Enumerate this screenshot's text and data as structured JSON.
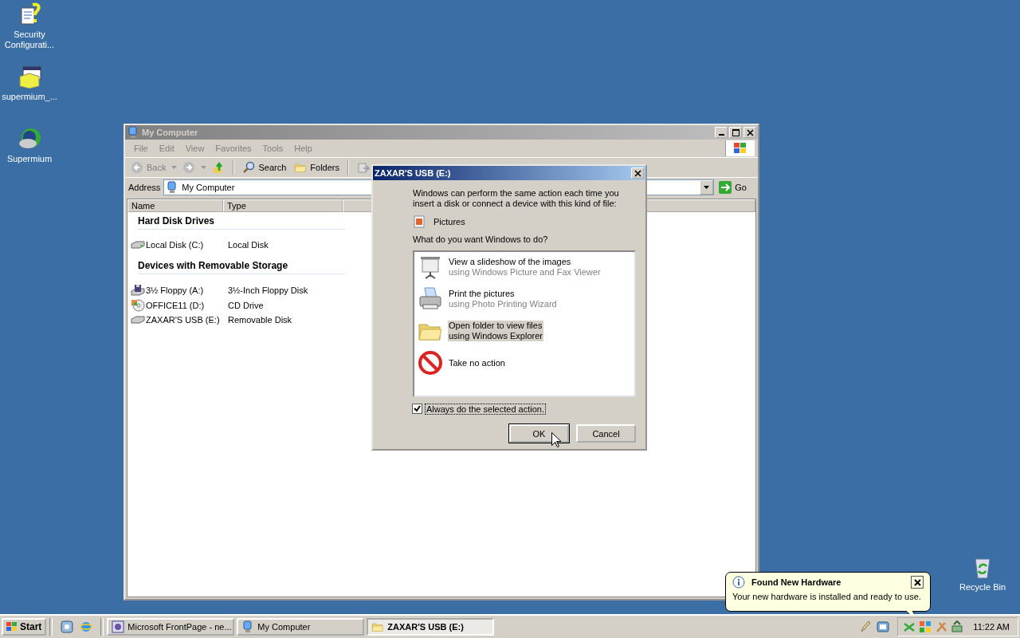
{
  "desktop_icons": [
    {
      "label": "Security Configurati...",
      "kind": "security"
    },
    {
      "label": "supermium_...",
      "kind": "installer"
    },
    {
      "label": "Supermium",
      "kind": "app"
    },
    {
      "label": "Recycle Bin",
      "kind": "recycle"
    }
  ],
  "explorer": {
    "title": "My Computer",
    "menu": [
      "File",
      "Edit",
      "View",
      "Favorites",
      "Tools",
      "Help"
    ],
    "toolbar": {
      "back": "Back",
      "search": "Search",
      "folders": "Folders"
    },
    "address": {
      "label": "Address",
      "value": "My Computer",
      "go": "Go"
    },
    "columns": [
      "Name",
      "Type"
    ],
    "groups": [
      {
        "heading": "Hard Disk Drives",
        "items": [
          {
            "name": "Local Disk (C:)",
            "type": "Local Disk",
            "kind": "hdd"
          }
        ]
      },
      {
        "heading": "Devices with Removable Storage",
        "items": [
          {
            "name": "3½ Floppy (A:)",
            "type": "3½-Inch Floppy Disk",
            "kind": "floppy"
          },
          {
            "name": "OFFICE11 (D:)",
            "type": "CD Drive",
            "kind": "cd"
          },
          {
            "name": "ZAXAR'S USB (E:)",
            "type": "Removable Disk",
            "kind": "usb"
          }
        ]
      }
    ]
  },
  "dialog": {
    "title": "ZAXAR'S USB (E:)",
    "intro": "Windows can perform the same action each time you insert a disk or connect a device with this kind of file:",
    "content_type": "Pictures",
    "question": "What do you want Windows to do?",
    "actions": [
      {
        "title": "View a slideshow of the images",
        "subtitle": "using Windows Picture and Fax Viewer",
        "kind": "slideshow",
        "selected": false
      },
      {
        "title": "Print the pictures",
        "subtitle": "using Photo Printing Wizard",
        "kind": "print",
        "selected": false
      },
      {
        "title": "Open folder to view files",
        "subtitle": "using Windows Explorer",
        "kind": "folder",
        "selected": true
      },
      {
        "title": "Take no action",
        "kind": "none",
        "selected": false
      }
    ],
    "always": {
      "label": "Always do the selected action.",
      "checked": true
    },
    "buttons": [
      "OK",
      "Cancel"
    ]
  },
  "balloon": {
    "title": "Found New Hardware",
    "text": "Your new hardware is installed and ready to use."
  },
  "taskbar": {
    "start": "Start",
    "tasks": [
      {
        "label": "Microsoft FrontPage - ne...",
        "kind": "frontpage",
        "selected": false
      },
      {
        "label": "My Computer",
        "kind": "computer",
        "selected": false
      },
      {
        "label": "ZAXAR'S USB (E:)",
        "kind": "folder",
        "selected": true
      }
    ],
    "clock": "11:22 AM"
  }
}
